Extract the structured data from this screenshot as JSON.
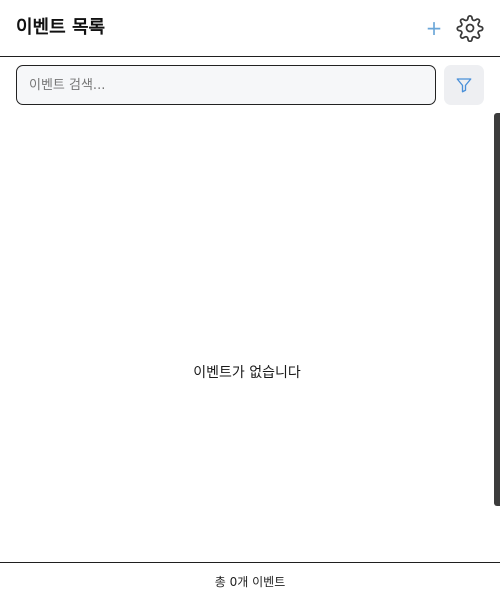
{
  "header": {
    "title": "이벤트 목록",
    "add_icon": "plus-icon",
    "settings_icon": "gear-icon",
    "add_glyph": "+"
  },
  "search": {
    "placeholder": "이벤트 검색...",
    "value": "",
    "filter_icon": "filter-icon"
  },
  "main": {
    "empty_message": "이벤트가 없습니다"
  },
  "footer": {
    "count_text": "총 0개 이벤트"
  },
  "colors": {
    "accent": "#6aa6d8",
    "filter_icon": "#4a90d9",
    "scrollbar": "#3c3c3c"
  }
}
